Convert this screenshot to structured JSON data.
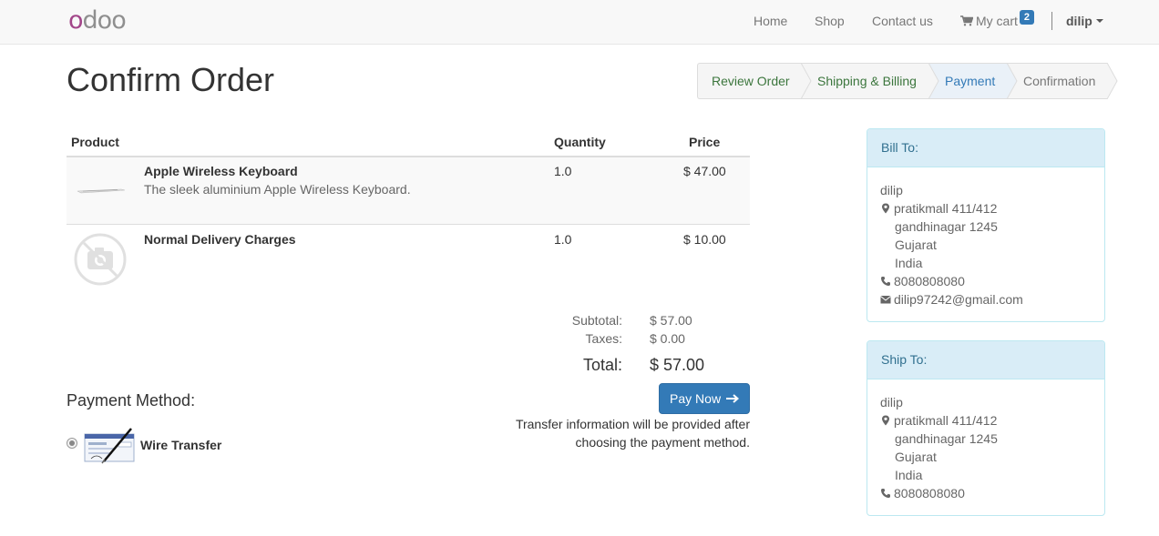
{
  "navbar": {
    "logo_first": "o",
    "logo_rest": "doo",
    "home": "Home",
    "shop": "Shop",
    "contact": "Contact us",
    "cart": "My cart",
    "cart_count": "2",
    "user": "dilip"
  },
  "page": {
    "title": "Confirm Order"
  },
  "wizard": {
    "steps": [
      {
        "label": "Review Order",
        "state": "done"
      },
      {
        "label": "Shipping & Billing",
        "state": "done"
      },
      {
        "label": "Payment",
        "state": "active"
      },
      {
        "label": "Confirmation",
        "state": "todo"
      }
    ]
  },
  "order": {
    "columns": [
      "Product",
      "Quantity",
      "Price"
    ],
    "lines": [
      {
        "name": "Apple Wireless Keyboard",
        "description": "The sleek aluminium Apple Wireless Keyboard.",
        "quantity": "1.0",
        "price": "$ 47.00"
      },
      {
        "name": "Normal Delivery Charges",
        "description": "",
        "quantity": "1.0",
        "price": "$ 10.00"
      }
    ],
    "subtotal_label": "Subtotal:",
    "subtotal": "$ 57.00",
    "taxes_label": "Taxes:",
    "taxes": "$ 0.00",
    "total_label": "Total:",
    "total": "$ 57.00"
  },
  "payment": {
    "title": "Payment Method:",
    "method": "Wire Transfer",
    "selected": true,
    "button": "Pay Now",
    "info": "Transfer information will be provided after choosing the payment method."
  },
  "bill_to": {
    "title": "Bill To:",
    "name": "dilip",
    "street": "pratikmall 411/412",
    "city": "gandhinagar 1245",
    "state": "Gujarat",
    "country": "India",
    "phone": "8080808080",
    "email": "dilip97242@gmail.com"
  },
  "ship_to": {
    "title": "Ship To:",
    "name": "dilip",
    "street": "pratikmall 411/412",
    "city": "gandhinagar 1245",
    "state": "Gujarat",
    "country": "India",
    "phone": "8080808080"
  },
  "colors": {
    "primary": "#337ab7",
    "success_text": "#3c763d",
    "info_bg": "#d9edf7",
    "info_border": "#bce8f1",
    "info_text": "#31708f",
    "logo_purple": "#a24689",
    "logo_gray": "#8f8f8f"
  },
  "icons": [
    "cart-icon",
    "caret-down-icon",
    "map-marker-icon",
    "phone-icon",
    "envelope-icon",
    "arrow-right-icon",
    "no-image-icon",
    "keyboard-image",
    "wire-transfer-image"
  ]
}
